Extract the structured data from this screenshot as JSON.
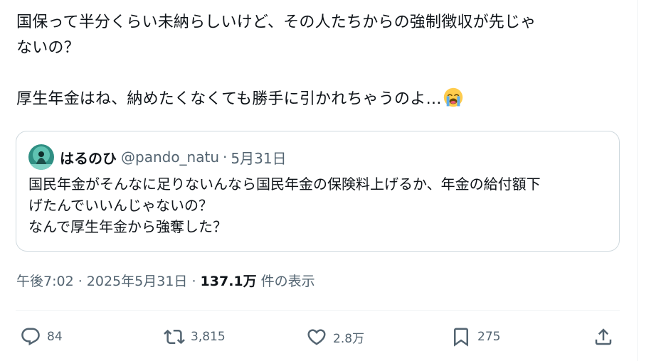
{
  "tweet": {
    "lines": [
      "国保って半分くらい未納らしいけど、その人たちからの強制徴収が先じゃ",
      "ないの？",
      "",
      "厚生年金はね、納めたくなくても勝手に引かれちゃうのよ…"
    ],
    "emoji": "loudly-crying-face"
  },
  "quote": {
    "display_name": "はるのひ",
    "handle": "@pando_natu",
    "separator": "·",
    "date": "5月31日",
    "lines": [
      "国民年金がそんなに足りないんなら国民年金の保険料上げるか、年金の給付額下",
      "げたんでいいんじゃないの？",
      "なんで厚生年金から強奪した？"
    ]
  },
  "meta": {
    "timestamp": "午後7:02 · 2025年5月31日 · ",
    "views": "137.1万",
    "views_suffix": " 件の表示"
  },
  "actions": {
    "reply": {
      "icon": "reply-icon",
      "count": "84"
    },
    "retweet": {
      "icon": "retweet-icon",
      "count": "3,815"
    },
    "like": {
      "icon": "heart-icon",
      "count": "2.8万"
    },
    "bookmark": {
      "icon": "bookmark-icon",
      "count": "275"
    },
    "share": {
      "icon": "share-icon"
    }
  },
  "colors": {
    "text": "#0f1419",
    "secondary": "#536471",
    "border": "#cfd9de",
    "divider": "#eff3f4"
  }
}
